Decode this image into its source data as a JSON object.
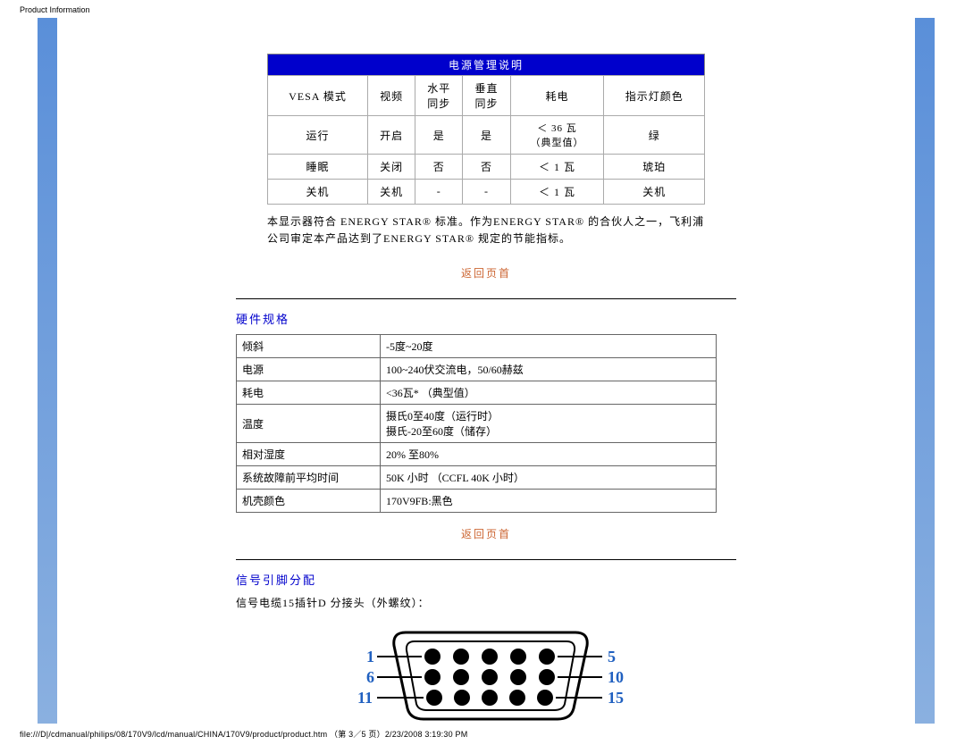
{
  "header": "Product Information",
  "footer": "file:///D|/cdmanual/philips/08/170V9/lcd/manual/CHINA/170V9/product/product.htm （第 3／5 页）2/23/2008 3:19:30 PM",
  "power": {
    "title": "电源管理说明",
    "headers": [
      "VESA 模式",
      "视频",
      "水平\n同步",
      "垂直\n同步",
      "耗电",
      "指示灯颜色"
    ],
    "rows": [
      [
        "运行",
        "开启",
        "是",
        "是",
        "＜ 36 瓦\n（典型值）",
        "绿"
      ],
      [
        "睡眠",
        "关闭",
        "否",
        "否",
        "＜ 1 瓦",
        "琥珀"
      ],
      [
        "关机",
        "关机",
        "-",
        "-",
        "＜ 1 瓦",
        "关机"
      ]
    ]
  },
  "energystar": "本显示器符合 ENERGY STAR® 标准。作为ENERGY STAR® 的合伙人之一，飞利浦公司审定本产品达到了ENERGY STAR® 规定的节能指标。",
  "backtop": "返回页首",
  "hw": {
    "title": "硬件规格",
    "rows": [
      [
        "倾斜",
        "-5度~20度"
      ],
      [
        "电源",
        "100~240伏交流电，50/60赫兹"
      ],
      [
        "耗电",
        "<36瓦* （典型值）"
      ],
      [
        "温度",
        "摄氏0至40度（运行时）\n摄氏-20至60度（储存）"
      ],
      [
        "相对湿度",
        "20% 至80%"
      ],
      [
        "系统故障前平均时间",
        "50K 小时 （CCFL 40K 小时）"
      ],
      [
        "机壳颜色",
        "170V9FB:黑色\n "
      ]
    ]
  },
  "pin": {
    "title": "信号引脚分配",
    "desc": "信号电缆15插针D 分接头（外螺纹）：",
    "labels": {
      "tl": "1",
      "tr": "5",
      "ml": "6",
      "mr": "10",
      "bl": "11",
      "br": "15"
    }
  }
}
